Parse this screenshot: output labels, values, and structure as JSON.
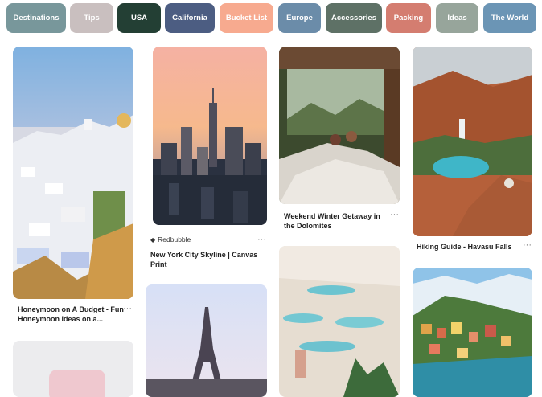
{
  "chips": [
    {
      "label": "Destinations",
      "color": "#78979b"
    },
    {
      "label": "Tips",
      "color": "#c9bfbf"
    },
    {
      "label": "USA",
      "color": "#233f34"
    },
    {
      "label": "California",
      "color": "#4c5d82"
    },
    {
      "label": "Bucket List",
      "color": "#f7aa8f"
    },
    {
      "label": "Europe",
      "color": "#6b8ca9"
    },
    {
      "label": "Accessories",
      "color": "#5e7166"
    },
    {
      "label": "Packing",
      "color": "#d47d70"
    },
    {
      "label": "Ideas",
      "color": "#97a59b"
    },
    {
      "label": "The World",
      "color": "#6b95b5"
    }
  ],
  "pins": {
    "santorini": {
      "title_line1": "Honeymoon on A Budget - Fun",
      "title_line2": "Honeymoon Ideas on a..."
    },
    "nyc": {
      "source": "Redbubble",
      "title_line1": "New York City Skyline | Canvas",
      "title_line2": "Print"
    },
    "dolomites": {
      "title_line1": "Weekend Winter Getaway in",
      "title_line2": "the Dolomites"
    },
    "havasu": {
      "title_line1": "Hiking Guide - Havasu Falls"
    }
  },
  "more_label": "···",
  "icons": {
    "source": "tag-icon",
    "more": "more-options-icon"
  }
}
